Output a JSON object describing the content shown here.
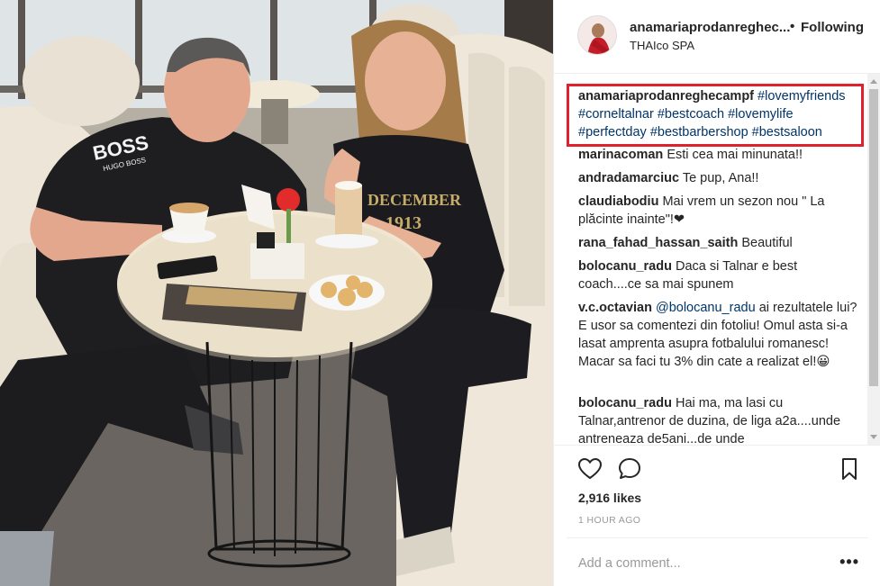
{
  "post": {
    "username": "anamariaprodanreghec...",
    "follow_separator": "•",
    "follow_label": "Following",
    "location": "THAIco SPA"
  },
  "caption": {
    "handle": "anamariaprodanreghecampf",
    "tags": [
      "#lovemyfriends",
      "#corneltalnar",
      "#bestcoach",
      "#lovemylife",
      "#perfectday",
      "#bestbarbershop",
      "#bestsaloon"
    ],
    "highlight_color": "#e0202c"
  },
  "comments": [
    {
      "user": "marinacoman",
      "text": "Esti cea mai minunata!!"
    },
    {
      "user": "andradamarciuc",
      "text": "Te pup, Ana!!"
    },
    {
      "user": "claudiabodiu",
      "text": "Mai vrem un sezon nou \" La plăcinte inainte\"!❤"
    },
    {
      "user": "rana_fahad_hassan_saith",
      "text": "Beautiful"
    },
    {
      "user": "bolocanu_radu",
      "text": "Daca si Talnar e best coach....ce sa mai spunem"
    },
    {
      "user": "v.c.octavian",
      "mention": "@bolocanu_radu",
      "text": "ai rezultatele lui? E usor sa comentezi din fotoliu! Omul asta si-a lasat amprenta asupra fotbalului romanesc! Macar sa faci tu 3% din cate a realizat el!😀"
    },
    {
      "user": "bolocanu_radu",
      "text": "Hai ma, ma lasi cu Talnar,antrenor de duzina, de liga a2a....unde antreneaza de5ani...de unde"
    }
  ],
  "actions": {
    "like_icon": "heart-outline",
    "comment_icon": "speech-bubble",
    "save_icon": "bookmark-outline",
    "likes": "2,916 likes",
    "time": "1 HOUR AGO",
    "add_comment_placeholder": "Add a comment...",
    "more_label": "•••"
  },
  "photo": {
    "shirt_text": "DECEMBER",
    "shirt_year": "1913",
    "brand_text": "BOSS",
    "brand_sub": "HUGO BOSS"
  }
}
